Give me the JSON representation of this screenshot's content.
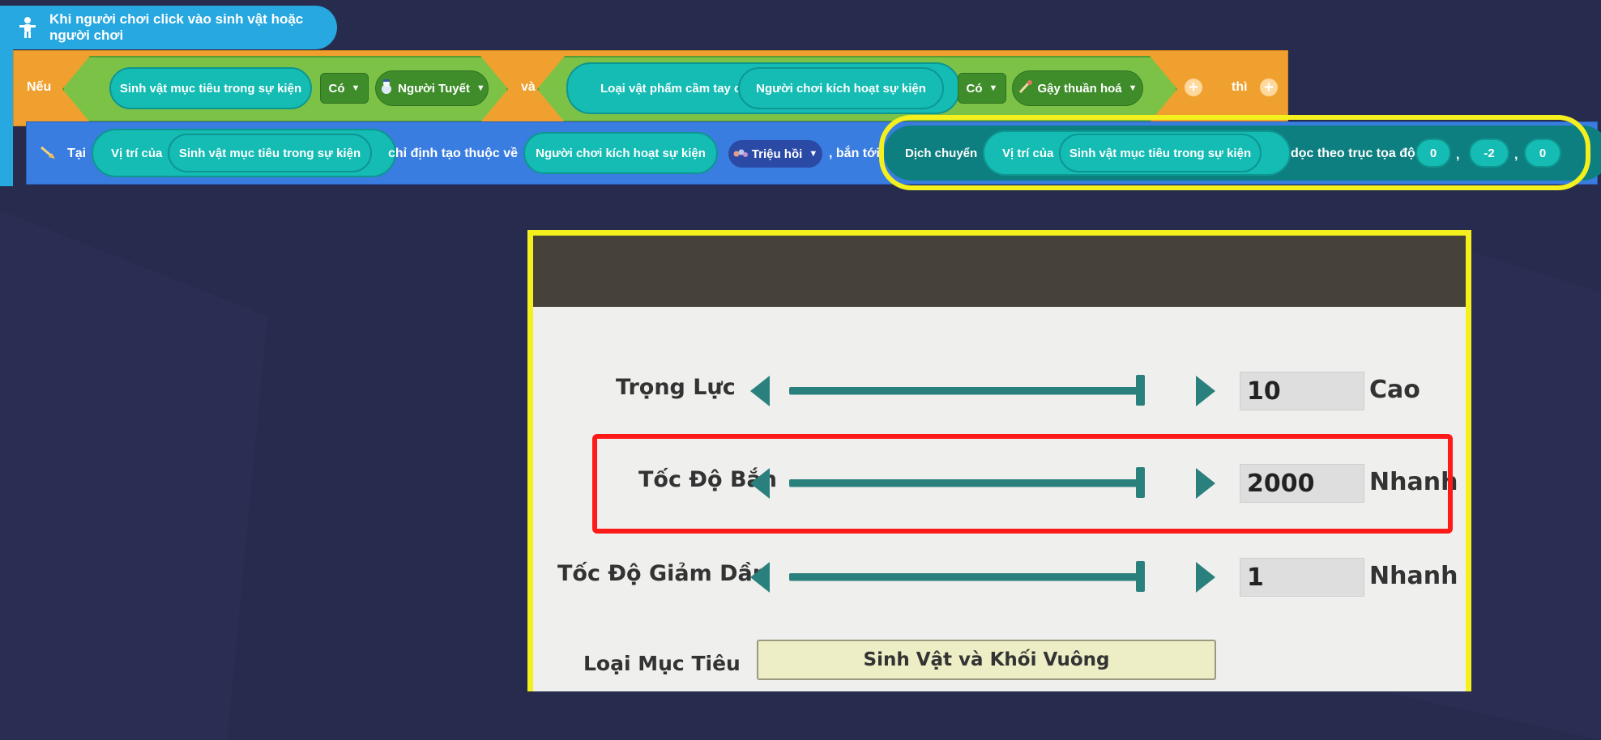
{
  "event": {
    "title": "Khi người chơi click vào sinh vật hoặc người chơi"
  },
  "if_block": {
    "neu_label": "Nếu",
    "cond1_subject": "Sinh vật mục tiêu trong sự kiện",
    "cond1_op": "Có",
    "cond1_value": "Người Tuyết",
    "and_label": "và",
    "cond2_prefix": "Loại vật phẩm cầm tay của",
    "cond2_subject": "Người chơi kích hoạt sự kiện",
    "cond2_op": "Có",
    "cond2_value": "Gậy thuần hoá",
    "then_label": "thì",
    "add_symbol": "+"
  },
  "action_block": {
    "tai_label": "Tại",
    "position_of": "Vị trí của",
    "target": "Sinh vật mục tiêu trong sự kiện",
    "specify_creator": "chỉ định tạo thuộc về",
    "creator": "Người chơi kích hoạt sự kiện",
    "summon_option": "Triệu hồi",
    "shoot_to": ", bắn tới",
    "move_label": "Dịch chuyển",
    "move_position_of": "Vị trí của",
    "move_target": "Sinh vật mục tiêu trong sự kiện",
    "axis_label": "dọc theo trục tọa độ (",
    "coord_x": "0",
    "coord_y": "-2",
    "coord_z": "0",
    "comma": ","
  },
  "settings_panel": {
    "rows": [
      {
        "label": "Trọng Lực",
        "value": "10",
        "unit": "Cao"
      },
      {
        "label": "Tốc Độ Bắn",
        "value": "2000",
        "unit": "Nhanh"
      },
      {
        "label": "Tốc Độ Giảm Dần",
        "value": "1",
        "unit": "Nhanh"
      }
    ],
    "target_type_label": "Loại Mục Tiêu",
    "target_type_value": "Sinh Vật và Khối Vuông"
  },
  "colors": {
    "event_block": "#27a8e0",
    "if_block": "#f0a02e",
    "condition_hex": "#7cc247",
    "reporter_pill": "#14bcb4",
    "action_block": "#3a7de0",
    "highlight_yellow": "#f3f01e",
    "highlight_red": "#ff1a1a",
    "slider": "#2a807c"
  }
}
